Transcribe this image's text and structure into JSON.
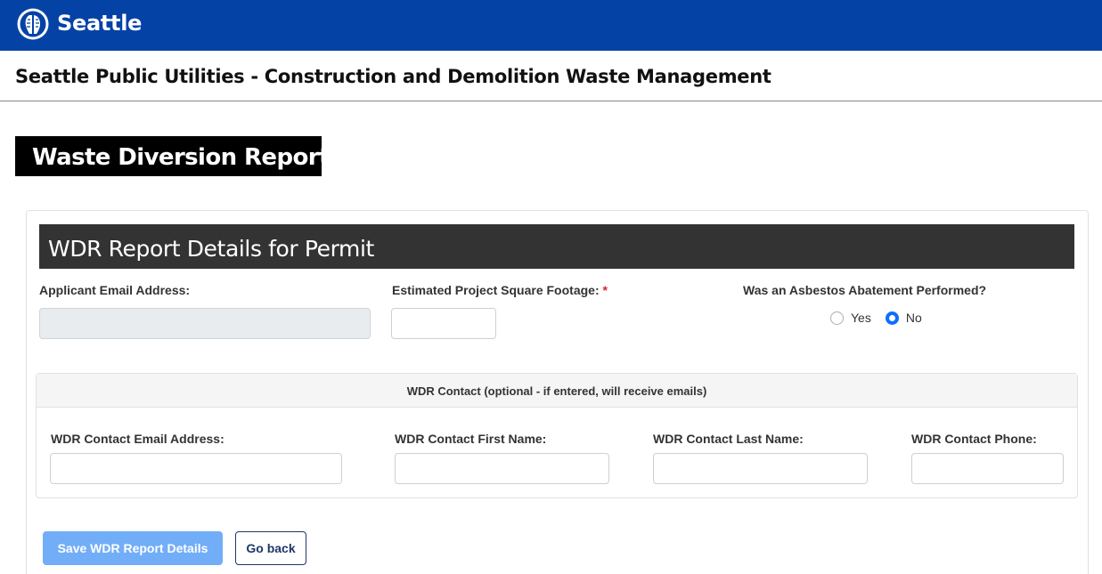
{
  "header": {
    "brand": "Seattle",
    "subtitle": "Seattle Public Utilities - Construction and Demolition Waste Management"
  },
  "page": {
    "title": "Waste Diversion Report"
  },
  "card": {
    "header": "WDR Report Details for Permit",
    "applicant_email_label": "Applicant Email Address:",
    "applicant_email_value": "",
    "sqft_label": "Estimated Project Square Footage:",
    "sqft_required_mark": "*",
    "sqft_value": "",
    "asbestos_label": "Was an Asbestos Abatement Performed?",
    "asbestos_options": [
      "Yes",
      "No"
    ],
    "asbestos_selected": "No"
  },
  "contact": {
    "header": "WDR Contact (optional - if entered, will receive emails)",
    "email_label": "WDR Contact Email Address:",
    "first_name_label": "WDR Contact First Name:",
    "last_name_label": "WDR Contact Last Name:",
    "phone_label": "WDR Contact Phone:"
  },
  "actions": {
    "save_label": "Save WDR Report Details",
    "back_label": "Go back"
  },
  "colors": {
    "topbar": "#0542a6",
    "card_header": "#333333",
    "primary_button": "#72adf8",
    "radio_checked": "#0d6efd"
  }
}
